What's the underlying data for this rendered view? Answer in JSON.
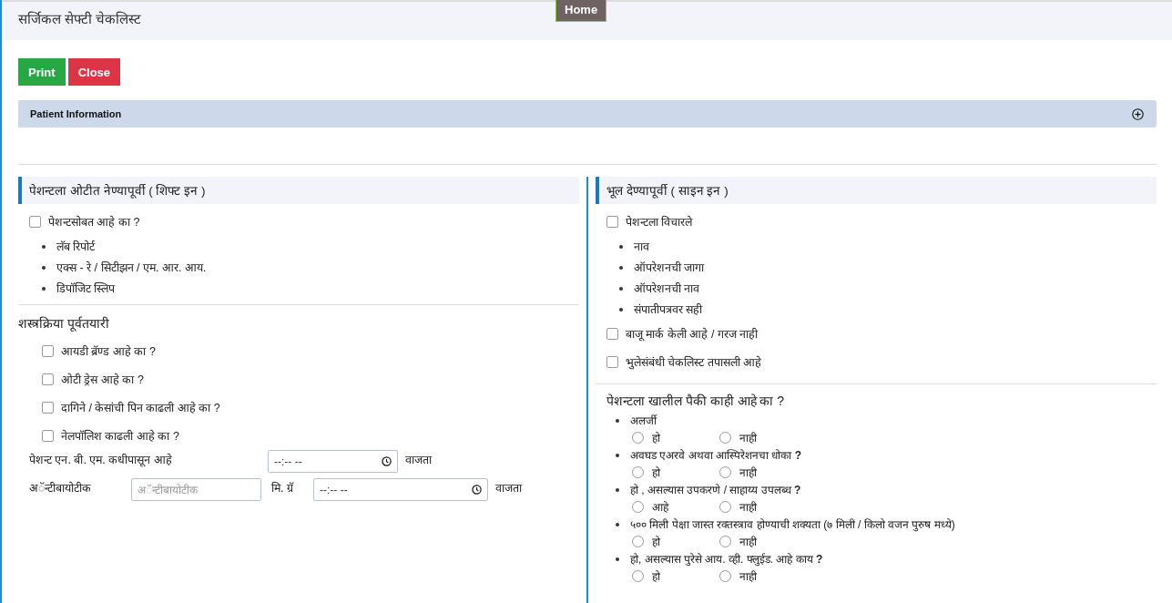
{
  "header": {
    "title": "सर्जिकल सेफ्टी चेकलिस्ट",
    "home_tab": "Home"
  },
  "buttons": [
    {
      "label": "Print",
      "kind": "success"
    },
    {
      "label": "Close",
      "kind": "danger"
    }
  ],
  "patient_info": {
    "label": "Patient Information",
    "expanded": false
  },
  "shift_in": {
    "heading": "पेशन्टला ओटीत नेण्यापूर्वी ( शिफ्ट इन )",
    "checks": [
      {
        "label": "पेशन्टसोबत आहे का ?",
        "checked": false,
        "bullets": [
          "लॅब रिपोर्ट",
          "एक्स - रे / सिटीझन / एम. आर. आय.",
          "डिपॉजिट स्लिप"
        ]
      }
    ],
    "prep_heading": "शस्त्रक्रिया पूर्वतयारी",
    "prep_checks": [
      {
        "label": "आयडी ब्रॅण्ड आहे का ?",
        "checked": false
      },
      {
        "label": "ओटी ड्रेस आहे का ?",
        "checked": false
      },
      {
        "label": "दागिने / केसांची पिन काढली आहे का ?",
        "checked": false
      },
      {
        "label": "नेलपॉलिश काढली आहे का ?",
        "checked": false
      }
    ],
    "nbm": {
      "label": "पेशन्ट एन. बी. एम. कधीपासून आहे",
      "time_placeholder": "--:-- --",
      "unit": "वाजता"
    },
    "antibiotic": {
      "label": "अॅन्टीबायोटीक",
      "placeholder": "अॅन्टीबायोटीक",
      "dose_label": "मि. ग्रॅ",
      "time_placeholder": "--:-- --",
      "unit": "वाजता"
    }
  },
  "sign_in": {
    "heading": "भूल देण्यापूर्वी ( साइन इन )",
    "checks": [
      {
        "label": "पेशन्टला विचारले",
        "checked": false,
        "bullets": [
          "नाव",
          "ऑपरेशनची जागा",
          "ऑपरेशनची नाव",
          "संपातीपत्रवर सही"
        ]
      },
      {
        "label": "बाजू मार्क केली आहे / गरज नाही",
        "checked": false
      },
      {
        "label": "भुलेसंबंधी चेकलिस्ट तपासली आहे",
        "checked": false
      }
    ],
    "question": "पेशन्टला खालील पैकी काही आहे का ?",
    "questions": [
      {
        "label": "अलर्जी",
        "options": [
          {
            "label": "हो",
            "selected": false
          },
          {
            "label": "नाही",
            "selected": false
          }
        ]
      },
      {
        "label": "अवघड एअरवे अथवा आस्पिरेशनचा धोका **?**",
        "options": [
          {
            "label": "हो",
            "selected": false
          },
          {
            "label": "नाही",
            "selected": false
          }
        ]
      },
      {
        "label": "हो , असल्यास उपकरणे / साहाय्य उपलब्ध **?**",
        "options": [
          {
            "label": "आहे",
            "selected": false
          },
          {
            "label": "नाही",
            "selected": false
          }
        ]
      },
      {
        "label": "५०० मिली पेक्षा जास्त रक्तस्त्राव होण्याची शक्यता (७ मिली / किलो वजन पुरुष मध्ये)",
        "options": [
          {
            "label": "हो",
            "selected": false
          },
          {
            "label": "नाही",
            "selected": false
          }
        ]
      },
      {
        "label": "हो, असल्यास पुरेसे आय. व्ही. फ्लुईड. आहे काय **?**",
        "options": [
          {
            "label": "हो",
            "selected": false
          },
          {
            "label": "नाही",
            "selected": false
          }
        ]
      }
    ]
  }
}
